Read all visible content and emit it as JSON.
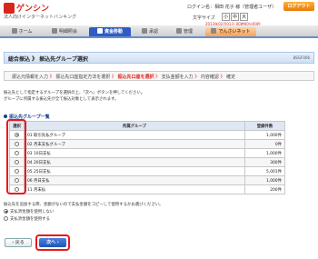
{
  "header": {
    "brand": "ゲンシン",
    "brand_sub": "法人向けインターネットバンキング",
    "login_info": "ログイン名：相田 花子 様（管理者ユーザ）",
    "logout_label": "ログアウト",
    "fontsize_label": "文字サイズ",
    "fontsize_small": "小",
    "fontsize_medium": "中",
    "fontsize_large": "大",
    "datetime": "2013年02月01日 00時00分00秒"
  },
  "nav": {
    "home": "ホーム",
    "inquiry": "明細照会",
    "transfer": "資金移動",
    "approval": "承認",
    "admin": "管理",
    "denshi": "でんさいネット"
  },
  "page": {
    "title": "総合振込 》 振込先グループ選択",
    "code": "BSGF006",
    "steps": [
      "振込元情報を入力",
      "振込先口座指定方法を選択",
      "振込先口座を選択",
      "支払金額を入力",
      "内容確認",
      "確定"
    ],
    "current_step_index": 2,
    "desc1": "振込先として指定するグループを選択の上、「次へ」ボタンを押してください。",
    "desc2": "グループに所属する振込先が全て振込対象として表示されます。"
  },
  "group_list": {
    "heading": "振込先グループ一覧",
    "col_select": "選択",
    "col_group": "所属グループ",
    "col_count": "登録件数",
    "rows": [
      {
        "group": "01 取引先払グループ",
        "count": "1,000件",
        "selected": true
      },
      {
        "group": "02 月末支払グループ",
        "count": "0件",
        "selected": false
      },
      {
        "group": "03 10日支払",
        "count": "1,000件",
        "selected": false
      },
      {
        "group": "04 20日支払",
        "count": "300件",
        "selected": false
      },
      {
        "group": "05 25日支払",
        "count": "5,001件",
        "selected": false
      },
      {
        "group": "06 月日支払",
        "count": "1,000件",
        "selected": false
      },
      {
        "group": "11 月末払",
        "count": "200件",
        "selected": false
      }
    ]
  },
  "options": {
    "note": "振込先を追加する際、金額がないので支払金額をコピーして使用するかお選びください。",
    "opt1": "支払済金額を使用しない",
    "opt2": "支払済金額を使用する"
  },
  "buttons": {
    "back": "戻る",
    "next": "次へ"
  },
  "colors": {
    "accent": "#2f5cc4",
    "highlight_frame": "#e8181f",
    "brand_red": "#d9261c"
  }
}
